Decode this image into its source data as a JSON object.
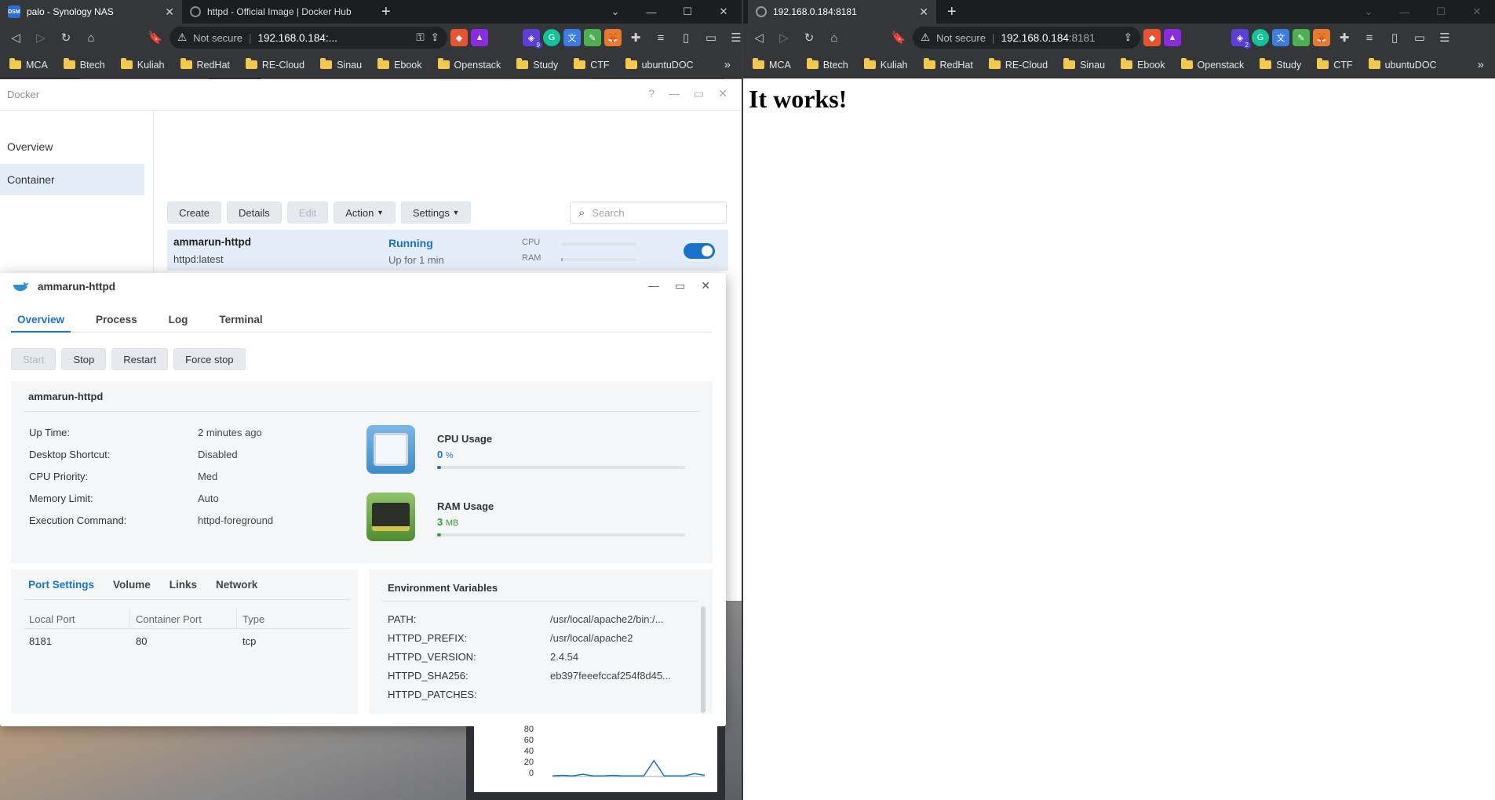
{
  "left_browser": {
    "tabs": [
      {
        "fav": "DSM",
        "title": "palo - Synology NAS",
        "active": true
      },
      {
        "fav": "",
        "title": "httpd - Official Image | Docker Hub",
        "active": false
      }
    ],
    "not_secure": "Not secure",
    "url": "192.168.0.184:...",
    "ext_badge": "9"
  },
  "right_browser": {
    "tab_title": "192.168.0.184:8181",
    "not_secure": "Not secure",
    "url_host": "192.168.0.184",
    "url_port": ":8181",
    "ext_badge": "2",
    "page_heading": "It works!"
  },
  "bookmarks": [
    "MCA",
    "Btech",
    "Kuliah",
    "RedHat",
    "RE-Cloud",
    "Sinau",
    "Ebook",
    "Openstack",
    "Study",
    "CTF",
    "ubuntuDOC"
  ],
  "docker": {
    "window_title": "Docker",
    "sidebar": [
      "Overview",
      "Container"
    ],
    "toolbar": {
      "create": "Create",
      "details": "Details",
      "edit": "Edit",
      "action": "Action",
      "settings": "Settings"
    },
    "search_placeholder": "Search",
    "container": {
      "name": "ammarun-httpd",
      "image": "httpd:latest",
      "status": "Running",
      "uptime": "Up for 1 min",
      "cpu_label": "CPU",
      "ram_label": "RAM"
    }
  },
  "detail": {
    "title": "ammarun-httpd",
    "tabs": [
      "Overview",
      "Process",
      "Log",
      "Terminal"
    ],
    "buttons": [
      "Start",
      "Stop",
      "Restart",
      "Force stop"
    ],
    "summary_title": "ammarun-httpd",
    "fields": [
      {
        "k": "Up Time:",
        "v": "2 minutes ago"
      },
      {
        "k": "Desktop Shortcut:",
        "v": "Disabled"
      },
      {
        "k": "CPU Priority:",
        "v": "Med"
      },
      {
        "k": "Memory Limit:",
        "v": "Auto"
      },
      {
        "k": "Execution Command:",
        "v": "httpd-foreground"
      }
    ],
    "cpu": {
      "title": "CPU Usage",
      "value": "0",
      "unit": "%",
      "fraction": 0.01,
      "color": "#1a73c9"
    },
    "ram": {
      "title": "RAM Usage",
      "value": "3",
      "unit": "MB",
      "fraction": 0.01,
      "color": "#2f9e2f"
    },
    "port_tabs": [
      "Port Settings",
      "Volume",
      "Links",
      "Network"
    ],
    "port_headers": [
      "Local Port",
      "Container Port",
      "Type"
    ],
    "port_rows": [
      [
        "8181",
        "80",
        "tcp"
      ]
    ],
    "env_title": "Environment Variables",
    "env": [
      {
        "k": "PATH:",
        "v": "/usr/local/apache2/bin:/..."
      },
      {
        "k": "HTTPD_PREFIX:",
        "v": "/usr/local/apache2"
      },
      {
        "k": "HTTPD_VERSION:",
        "v": "2.4.54"
      },
      {
        "k": "HTTPD_SHA256:",
        "v": "eb397feeefccaf254f8d45..."
      },
      {
        "k": "HTTPD_PATCHES:",
        "v": ""
      }
    ]
  },
  "resource_monitor": {
    "ticks": [
      "80",
      "60",
      "40",
      "20",
      "0"
    ],
    "series": [
      1,
      2,
      1,
      4,
      1,
      1,
      2,
      1,
      1,
      1,
      28,
      1,
      1,
      1,
      5,
      2
    ]
  }
}
